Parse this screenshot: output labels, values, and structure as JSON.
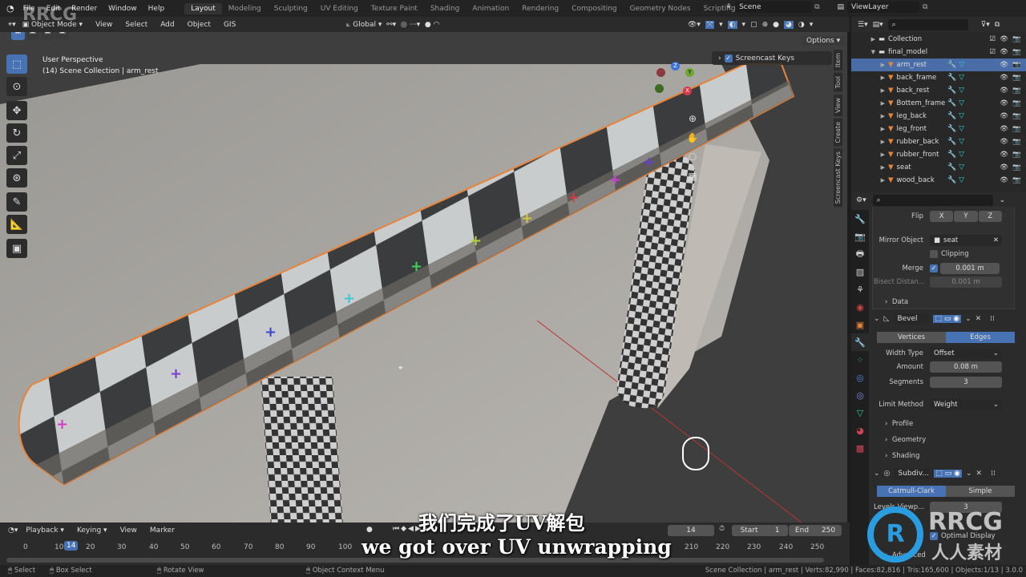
{
  "menu": {
    "items": [
      "File",
      "Edit",
      "Render",
      "Window",
      "Help"
    ]
  },
  "workspaces": [
    "Layout",
    "Modeling",
    "Sculpting",
    "UV Editing",
    "Texture Paint",
    "Shading",
    "Animation",
    "Rendering",
    "Compositing",
    "Geometry Nodes",
    "Scripting"
  ],
  "active_workspace": "Layout",
  "add_workspace": "+",
  "scene": {
    "label": "Scene",
    "view_layer": "ViewLayer"
  },
  "viewport_header": {
    "mode": "Object Mode",
    "menus": [
      "View",
      "Select",
      "Add",
      "Object",
      "GIS"
    ],
    "orientation": "Global",
    "options": "Options"
  },
  "viewport": {
    "perspective": "User Perspective",
    "collection_info": "(14) Scene Collection | arm_rest",
    "screencast_keys": "Screencast Keys",
    "side_tabs": [
      "Item",
      "Tool",
      "View",
      "Create",
      "Screencast Keys"
    ],
    "gizmo": {
      "x": "X",
      "y": "Y",
      "z": "Z"
    }
  },
  "outliner": {
    "items": [
      {
        "name": "Collection",
        "level": 0
      },
      {
        "name": "final_model",
        "level": 0
      },
      {
        "name": "arm_rest",
        "selected": true
      },
      {
        "name": "back_frame"
      },
      {
        "name": "back_rest"
      },
      {
        "name": "Bottem_frame"
      },
      {
        "name": "leg_back"
      },
      {
        "name": "leg_front"
      },
      {
        "name": "rubber_back"
      },
      {
        "name": "rubber_front"
      },
      {
        "name": "seat"
      },
      {
        "name": "wood_back"
      }
    ]
  },
  "properties": {
    "mirror": {
      "bisect_label": "Bisect",
      "flip_label": "Flip",
      "axes": [
        "X",
        "Y",
        "Z"
      ],
      "mirror_object_label": "Mirror Object",
      "mirror_object": "seat",
      "clipping_label": "Clipping",
      "clipping": false,
      "merge_label": "Merge",
      "merge": true,
      "merge_value": "0.001 m",
      "bisect_distance_label": "Bisect Distan...",
      "bisect_distance": "0.001 m",
      "data_label": "Data"
    },
    "bevel": {
      "name": "Bevel",
      "affect_options": [
        "Vertices",
        "Edges"
      ],
      "affect": "Edges",
      "width_type_label": "Width Type",
      "width_type": "Offset",
      "amount_label": "Amount",
      "amount": "0.08 m",
      "segments_label": "Segments",
      "segments": "3",
      "limit_method_label": "Limit Method",
      "limit_method": "Weight",
      "subpanels": [
        "Profile",
        "Geometry",
        "Shading"
      ]
    },
    "subdiv": {
      "name": "Subdiv...",
      "types": [
        "Catmull-Clark",
        "Simple"
      ],
      "type": "Catmull-Clark",
      "levels_label": "Levels Viewp...",
      "levels": "3",
      "optimal_display_label": "Optimal Display",
      "optimal_display": true,
      "advanced_label": "Advanced"
    }
  },
  "timeline": {
    "menus": [
      "Playback",
      "Keying",
      "View",
      "Marker"
    ],
    "current_frame": "14",
    "start_label": "Start",
    "start": "1",
    "end_label": "End",
    "end": "250",
    "ticks": [
      "0",
      "10",
      "20",
      "30",
      "40",
      "50",
      "60",
      "70",
      "80",
      "90",
      "100",
      "210",
      "220",
      "230",
      "240",
      "250"
    ]
  },
  "status": {
    "select": "Select",
    "box_select": "Box Select",
    "rotate": "Rotate View",
    "context": "Object Context Menu",
    "stats": "Scene Collection | arm_rest | Verts:82,990 | Faces:82,816 | Tris:165,600 | Objects:1/13 | 3.0.0"
  },
  "subtitles": {
    "zh": "我们完成了UV解包",
    "en": "we got over UV unwrapping"
  },
  "watermark": {
    "text": "RRCG",
    "cn": "人人素材"
  },
  "colors": {
    "accent": "#4772b3",
    "selection_outline": "#e8843a",
    "mesh_icon": "#e8843a"
  }
}
